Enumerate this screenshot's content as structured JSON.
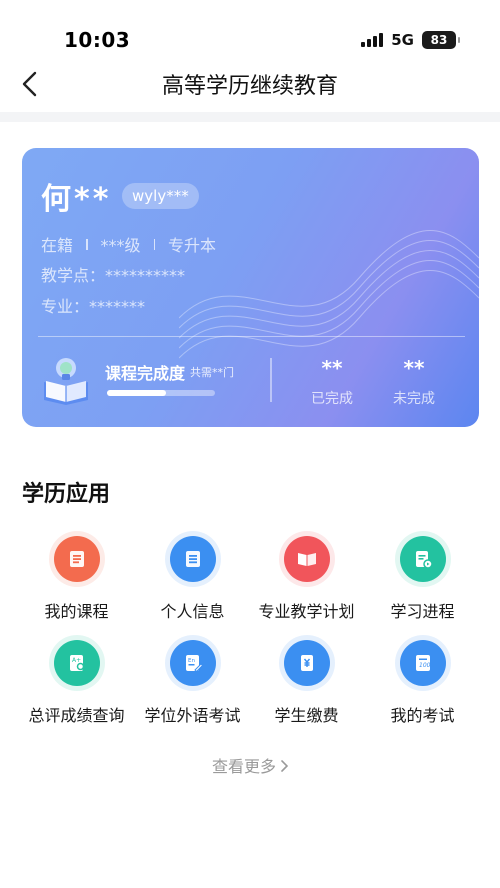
{
  "status_bar": {
    "time": "10:03",
    "network": "5G",
    "battery": "83"
  },
  "nav": {
    "title": "高等学历继续教育"
  },
  "student": {
    "name": "何**",
    "account": "wyly***",
    "status": "在籍",
    "grade": "***级",
    "level": "专升本",
    "center": "教学点：**********",
    "major": "专业：*******",
    "progress_title": "课程完成度",
    "progress_sub": "共需**门",
    "progress_fraction": 0.55,
    "completed_value": "**",
    "completed_label": "已完成",
    "pending_value": "**",
    "pending_label": "未完成"
  },
  "section": {
    "title": "学历应用"
  },
  "apps": [
    {
      "label": "我的课程",
      "icon": "course-list-icon",
      "color": "#f36b4e"
    },
    {
      "label": "个人信息",
      "icon": "profile-doc-icon",
      "color": "#3b8ff1"
    },
    {
      "label": "专业教学计划",
      "icon": "open-book-icon",
      "color": "#f1555b"
    },
    {
      "label": "学习进程",
      "icon": "progress-doc-icon",
      "color": "#23c2a0"
    },
    {
      "label": "总评成绩查询",
      "icon": "score-search-icon",
      "color": "#23c2a0"
    },
    {
      "label": "学位外语考试",
      "icon": "language-exam-icon",
      "color": "#3b8ff1"
    },
    {
      "label": "学生缴费",
      "icon": "payment-icon",
      "color": "#3b8ff1"
    },
    {
      "label": "我的考试",
      "icon": "exam-paper-icon",
      "color": "#3b8ff1"
    }
  ],
  "more": {
    "label": "查看更多"
  }
}
